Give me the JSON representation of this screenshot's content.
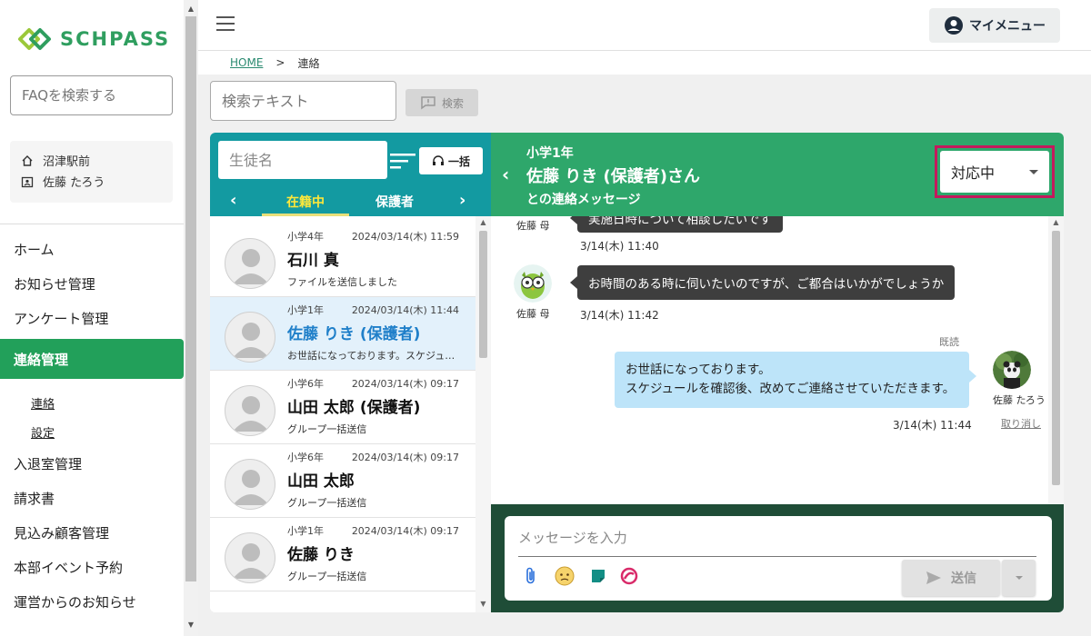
{
  "app": {
    "logo_text": "SCHPASS",
    "brand_color": "#2f9e5f"
  },
  "sidebar": {
    "faq_placeholder": "FAQを検索する",
    "school": "沼津駅前",
    "user": "佐藤 たろう",
    "nav": [
      {
        "label": "ホーム"
      },
      {
        "label": "お知らせ管理"
      },
      {
        "label": "アンケート管理"
      },
      {
        "label": "連絡管理",
        "active": true
      },
      {
        "label": "入退室管理"
      },
      {
        "label": "請求書"
      },
      {
        "label": "見込み顧客管理"
      },
      {
        "label": "本部イベント予約"
      },
      {
        "label": "運営からのお知らせ"
      }
    ],
    "subnav": [
      {
        "label": "連絡"
      },
      {
        "label": "設定"
      }
    ]
  },
  "header": {
    "my_menu": "マイメニュー"
  },
  "breadcrumb": {
    "home": "HOME",
    "separator": ">",
    "current": "連絡"
  },
  "search": {
    "placeholder": "検索テキスト",
    "button": "検索"
  },
  "list": {
    "student_placeholder": "生徒名",
    "bulk_button": "一括",
    "tabs": [
      {
        "label": "在籍中",
        "active": true
      },
      {
        "label": "保護者"
      }
    ],
    "items": [
      {
        "grade": "小学4年",
        "date": "2024/03/14(木) 11:59",
        "name": "石川 真",
        "message": "ファイルを送信しました"
      },
      {
        "grade": "小学1年",
        "date": "2024/03/14(木) 11:44",
        "name": "佐藤 りき (保護者)",
        "message": "お世話になっております。スケジュールを確認後、改めてご連絡させていただきます。",
        "selected": true
      },
      {
        "grade": "小学6年",
        "date": "2024/03/14(木) 09:17",
        "name": "山田 太郎 (保護者)",
        "message": "グループ一括送信"
      },
      {
        "grade": "小学6年",
        "date": "2024/03/14(木) 09:17",
        "name": "山田 太郎",
        "message": "グループ一括送信"
      },
      {
        "grade": "小学1年",
        "date": "2024/03/14(木) 09:17",
        "name": "佐藤 りき",
        "message": "グループ一括送信"
      }
    ]
  },
  "chat": {
    "grade": "小学1年",
    "title": "佐藤 りき (保護者)さん",
    "subtitle": "との連絡メッセージ",
    "status": "対応中",
    "messages": [
      {
        "sender": "佐藤 母",
        "text": "実施日時について相談したいです",
        "time": "3/14(木) 11:40"
      },
      {
        "sender": "佐藤 母",
        "text": "お時間のある時に伺いたいのですが、ご都合はいかがでしょうか",
        "time": "3/14(木) 11:42"
      },
      {
        "sender": "佐藤 たろう",
        "read": "既読",
        "text_lines": [
          "お世話になっております。",
          "スケジュールを確認後、改めてご連絡させていただきます。"
        ],
        "time": "3/14(木) 11:44",
        "cancel": "取り消し"
      }
    ],
    "composer": {
      "placeholder": "メッセージを入力",
      "send": "送信"
    }
  },
  "icons": [
    "home-icon",
    "badge-icon",
    "hamburger-icon",
    "account-icon",
    "feedback-icon",
    "sort-icon",
    "headset-icon",
    "chevron-left-icon",
    "chevron-right-icon",
    "paperclip-icon",
    "emoji-icon",
    "sticker-icon",
    "stamp-icon",
    "send-icon"
  ],
  "colors": {
    "list_header": "#139aa1",
    "chat_header": "#2ea76b",
    "composer_bg": "#1f4d37",
    "status_highlight": "#c4195d",
    "selected_name": "#1f7fc9"
  }
}
